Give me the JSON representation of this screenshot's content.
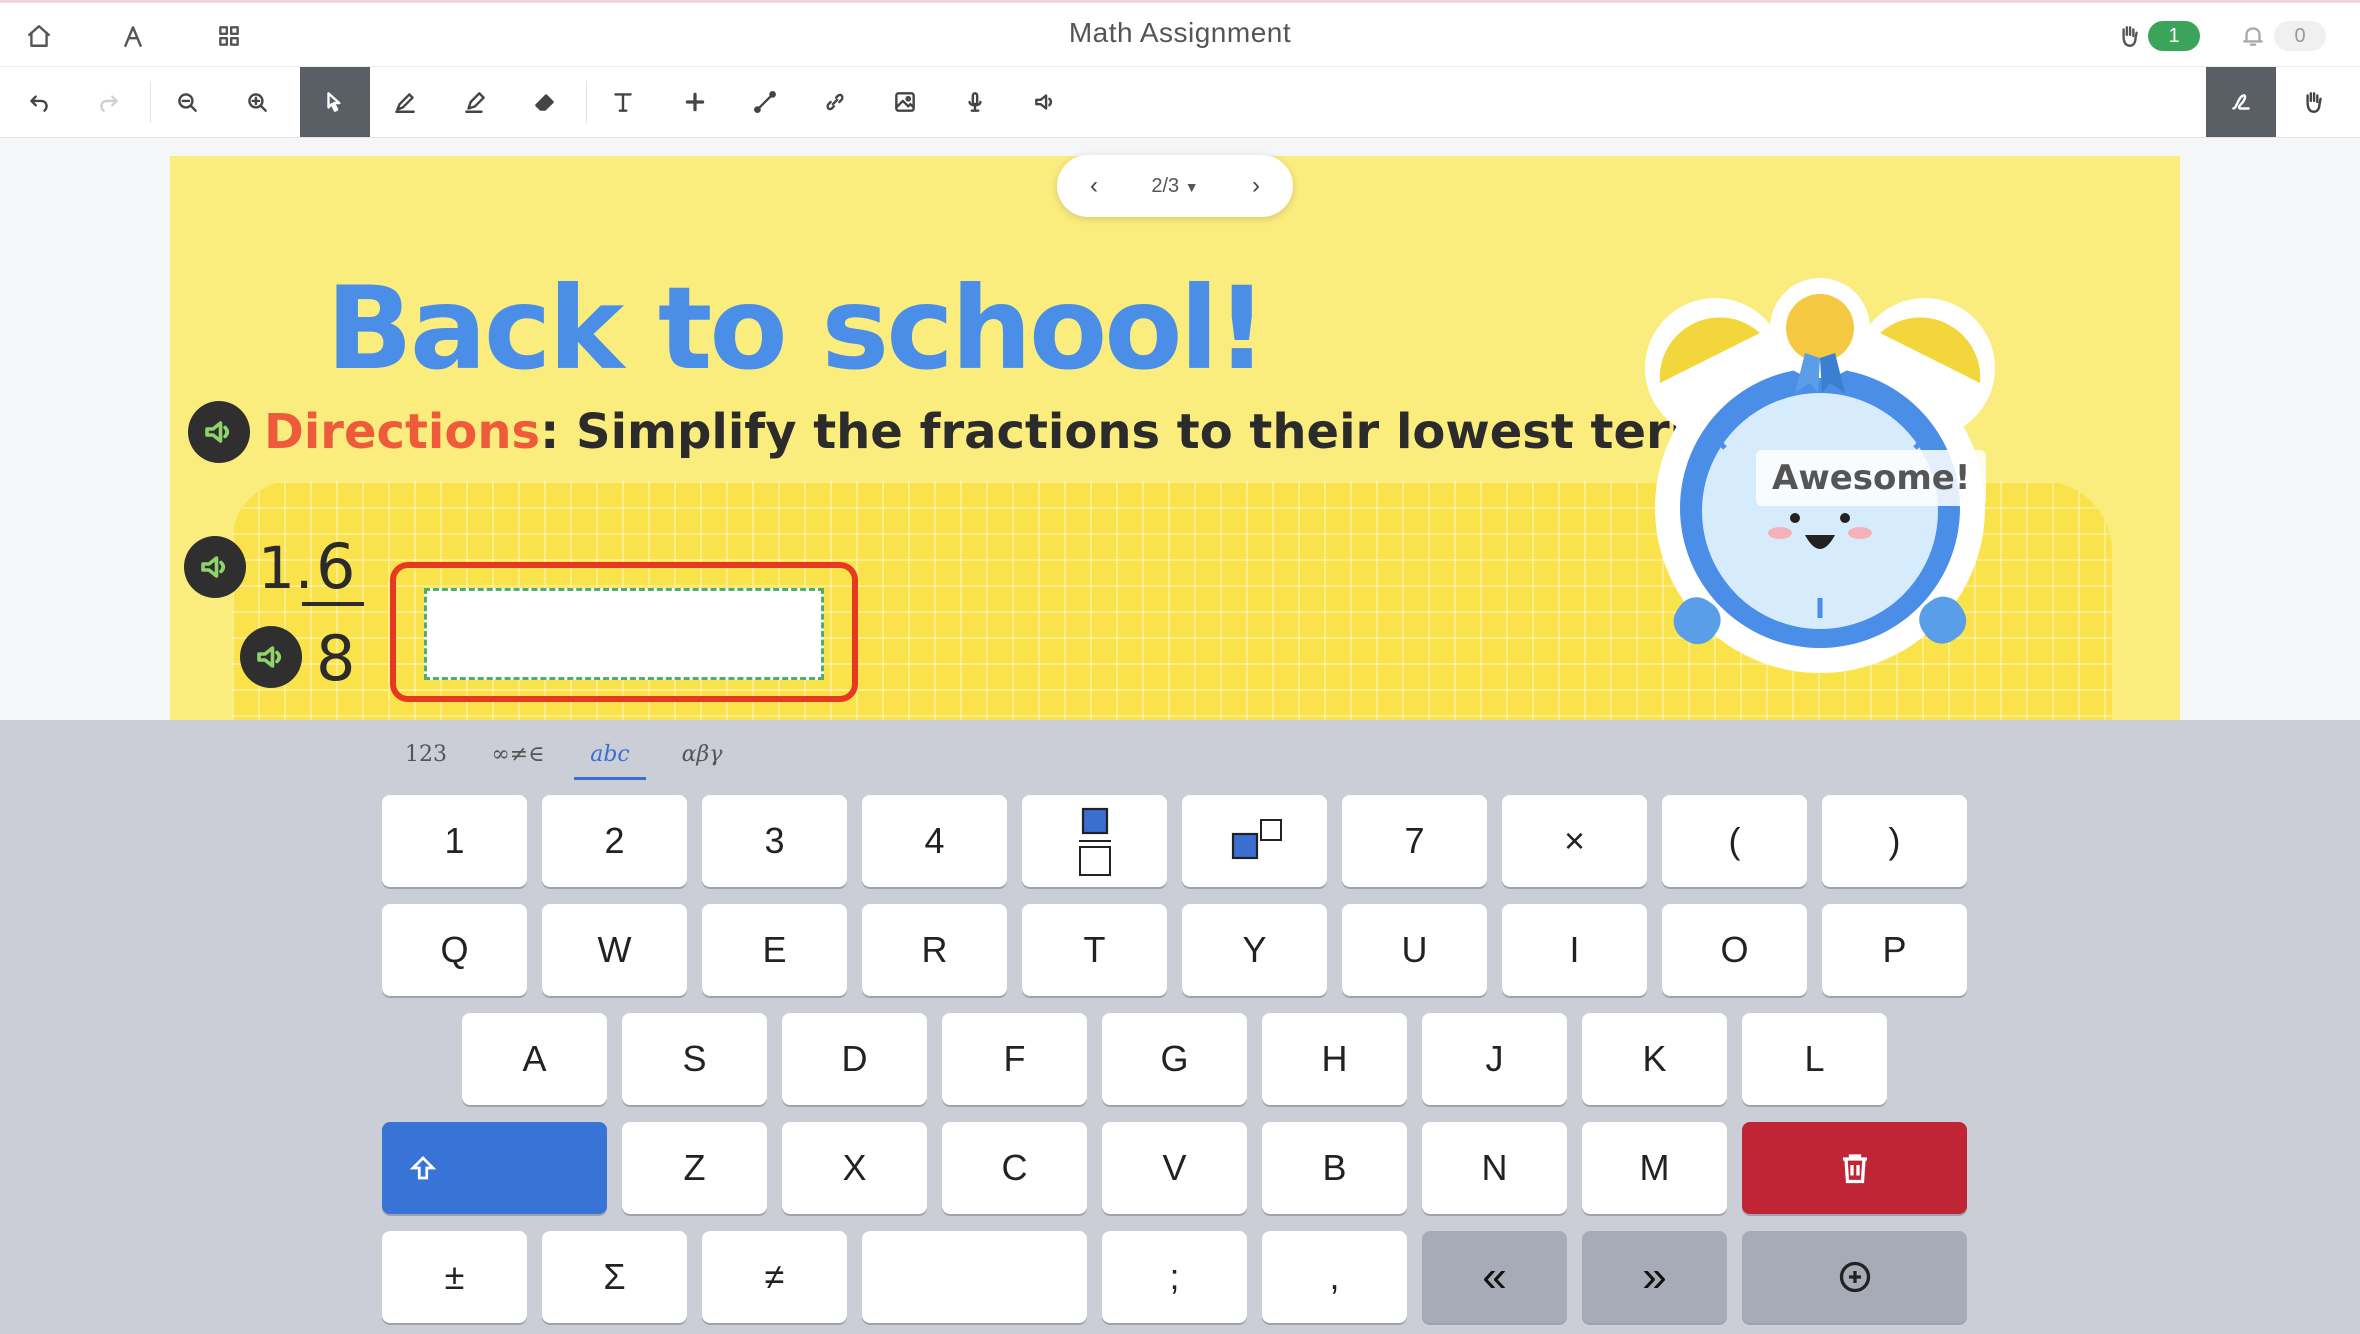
{
  "header": {
    "title": "Math Assignment",
    "raise_hand_count": "1",
    "notification_count": "0",
    "colors": {
      "raise_hand_pill": "#3aa45a",
      "notification_pill": "#f0f0f0"
    }
  },
  "toolbar": {
    "tools": [
      "undo-icon",
      "redo-icon",
      "zoom-out-icon",
      "zoom-in-icon",
      "select-icon",
      "pen-icon",
      "highlighter-icon",
      "eraser-icon",
      "text-icon",
      "add-icon",
      "line-icon",
      "link-icon",
      "image-icon",
      "microphone-icon",
      "speaker-icon"
    ],
    "right_tools": [
      "handwriting-icon",
      "hand-icon"
    ]
  },
  "pager": {
    "label": "2/3"
  },
  "slide": {
    "heading": "Back to school!",
    "directions_label": "Directions",
    "directions_text": ": Simplify the fractions to their lowest terms.",
    "question_number": "1.",
    "numerator": "6",
    "denominator": "8",
    "answer_value": "",
    "badge_text": "Awesome!",
    "colors": {
      "background": "#fbec7e",
      "heading": "#4a8ee8",
      "directions": "#ee5b3b",
      "highlight": "#e53a1f"
    }
  },
  "keyboard": {
    "tabs": [
      "123",
      "∞≠∈",
      "abc",
      "αβγ"
    ],
    "active_tab": "abc",
    "row1": [
      "1",
      "2",
      "3",
      "4",
      "",
      "",
      "7",
      "×",
      "(",
      ")"
    ],
    "row2": [
      "Q",
      "W",
      "E",
      "R",
      "T",
      "Y",
      "U",
      "I",
      "O",
      "P"
    ],
    "row3": [
      "A",
      "S",
      "D",
      "F",
      "G",
      "H",
      "J",
      "K",
      "L"
    ],
    "row4": [
      "Z",
      "X",
      "C",
      "V",
      "B",
      "N",
      "M"
    ],
    "row5": [
      "±",
      "Σ",
      "≠",
      "",
      ";",
      ",",
      "«",
      "»"
    ],
    "colors": {
      "shift": "#3873d6",
      "delete": "#c02535",
      "dark": "#a6abb6"
    }
  }
}
